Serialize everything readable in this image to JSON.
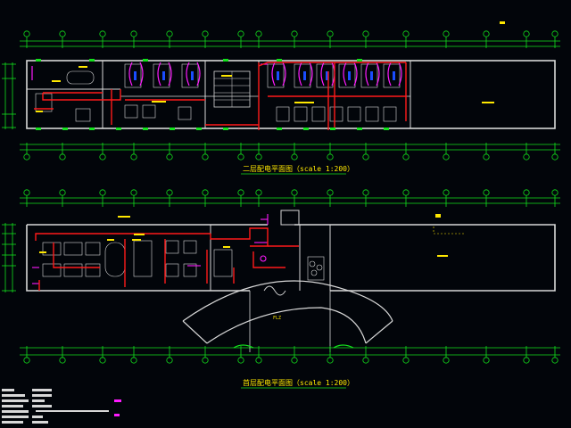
{
  "drawing": {
    "plan_top_title": "二层配电平面图（scale 1:200）",
    "plan_bottom_title": "首层配电平面图（scale 1:200）",
    "bottom_door_label": "FLZ",
    "colors": {
      "background": "#02050a",
      "wall": "#d8d8d8",
      "dimension": "#13e01c",
      "circuit": "#ff1a1a",
      "equipment": "#ff1aff",
      "fixture": "#1a4dff",
      "annotation": "#ffe800"
    }
  }
}
